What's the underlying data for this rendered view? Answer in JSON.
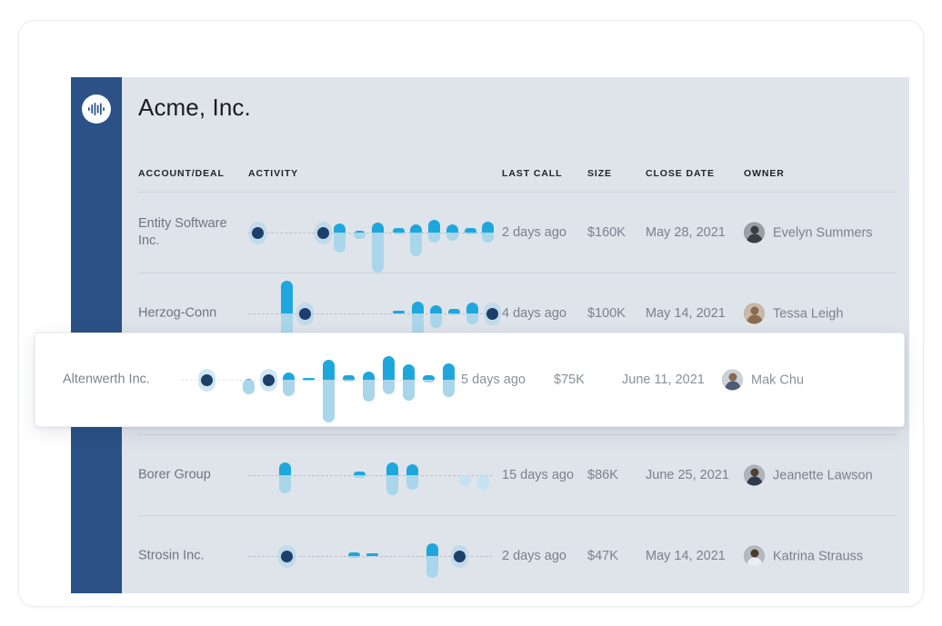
{
  "app": {
    "title": "Acme, Inc.",
    "logo_icon": "soundwave-icon",
    "sidebar_color": "#2b5186",
    "panel_color": "#dfe3ea"
  },
  "palette": {
    "dark_navy": "#1d3f6b",
    "accent_blue": "#1ea7dc",
    "light_blue": "#a9d6ea",
    "pale_blue": "#c6e2f1"
  },
  "table": {
    "columns": [
      {
        "key": "account",
        "label": "ACCOUNT/DEAL"
      },
      {
        "key": "activity",
        "label": "ACTIVITY"
      },
      {
        "key": "lastcall",
        "label": "LAST CALL"
      },
      {
        "key": "size",
        "label": "SIZE"
      },
      {
        "key": "closedate",
        "label": "CLOSE DATE"
      },
      {
        "key": "owner",
        "label": "OWNER"
      }
    ],
    "rows": [
      {
        "account": "Entity Software Inc.",
        "lastcall": "2 days ago",
        "size": "$160K",
        "closedate": "May 28, 2021",
        "owner": "Evelyn Summers",
        "avatar": "avatar-evelyn-summers"
      },
      {
        "account": "Herzog-Conn",
        "lastcall": "4 days ago",
        "size": "$100K",
        "closedate": "May 14, 2021",
        "owner": "Tessa Leigh",
        "avatar": "avatar-tessa-leigh"
      },
      {
        "account": "Borer Group",
        "lastcall": "15 days ago",
        "size": "$86K",
        "closedate": "June 25, 2021",
        "owner": "Jeanette Lawson",
        "avatar": "avatar-jeanette-lawson"
      },
      {
        "account": "Strosin Inc.",
        "lastcall": "2 days ago",
        "size": "$47K",
        "closedate": "May 14, 2021",
        "owner": "Katrina Strauss",
        "avatar": "avatar-katrina-strauss"
      }
    ],
    "highlighted_row": {
      "account": "Altenwerth Inc.",
      "lastcall": "5 days ago",
      "size": "$75K",
      "closedate": "June 11, 2021",
      "owner": "Mak Chu",
      "avatar": "avatar-mak-chu"
    }
  },
  "chart_data": {
    "type": "bar",
    "title": "Activity sparklines per account",
    "description": "Diverging capsule sparkline; positive (up) segment drawn in accent blue above a dashed zero baseline, negative (down) segment in light blue below. Dark navy circles mark zero/neutral activity markers.",
    "xlabel": "",
    "ylabel": "",
    "grid": false,
    "legend": "none",
    "baseline": 0,
    "series": [
      {
        "name": "Entity Software Inc.",
        "marks": [
          {
            "x": 4,
            "up": 0,
            "down": 0,
            "type": "dot"
          },
          {
            "x": 76,
            "up": 0,
            "down": 0,
            "type": "dot"
          },
          {
            "x": 94,
            "up": 10,
            "down": 22,
            "type": "pill"
          },
          {
            "x": 116,
            "up": 2,
            "down": 7,
            "type": "pill"
          },
          {
            "x": 136,
            "up": 11,
            "down": 44,
            "type": "pill"
          },
          {
            "x": 159,
            "up": 5,
            "down": 2,
            "type": "pill"
          },
          {
            "x": 178,
            "up": 9,
            "down": 26,
            "type": "pill"
          },
          {
            "x": 198,
            "up": 14,
            "down": 11,
            "type": "pill"
          },
          {
            "x": 218,
            "up": 9,
            "down": 9,
            "type": "pill"
          },
          {
            "x": 238,
            "up": 5,
            "down": 2,
            "type": "pill"
          },
          {
            "x": 257,
            "up": 12,
            "down": 11,
            "type": "pill"
          }
        ]
      },
      {
        "name": "Herzog-Conn",
        "marks": [
          {
            "x": 36,
            "up": 36,
            "down": 40,
            "type": "pill"
          },
          {
            "x": 56,
            "up": 0,
            "down": 0,
            "type": "dot"
          },
          {
            "x": 159,
            "up": 3,
            "down": 0,
            "type": "pill"
          },
          {
            "x": 180,
            "up": 13,
            "down": 25,
            "type": "pill"
          },
          {
            "x": 200,
            "up": 9,
            "down": 16,
            "type": "pill"
          },
          {
            "x": 220,
            "up": 5,
            "down": 2,
            "type": "pill"
          },
          {
            "x": 240,
            "up": 12,
            "down": 12,
            "type": "pill"
          },
          {
            "x": 262,
            "up": 0,
            "down": 0,
            "type": "dot"
          }
        ]
      },
      {
        "name": "Altenwerth Inc.",
        "marks": [
          {
            "x": 22,
            "up": 0,
            "down": 0,
            "type": "dot"
          },
          {
            "x": 68,
            "up": 1,
            "down": 16,
            "type": "pill"
          },
          {
            "x": 90,
            "up": 0,
            "down": 0,
            "type": "dot"
          },
          {
            "x": 112,
            "up": 8,
            "down": 18,
            "type": "pill"
          },
          {
            "x": 134,
            "up": 2,
            "down": 1,
            "type": "pill"
          },
          {
            "x": 156,
            "up": 22,
            "down": 47,
            "type": "pill"
          },
          {
            "x": 178,
            "up": 5,
            "down": 2,
            "type": "pill"
          },
          {
            "x": 200,
            "up": 9,
            "down": 24,
            "type": "pill"
          },
          {
            "x": 222,
            "up": 26,
            "down": 16,
            "type": "pill"
          },
          {
            "x": 244,
            "up": 17,
            "down": 23,
            "type": "pill"
          },
          {
            "x": 266,
            "up": 5,
            "down": 3,
            "type": "pill"
          },
          {
            "x": 288,
            "up": 18,
            "down": 19,
            "type": "pill"
          }
        ]
      },
      {
        "name": "Borer Group",
        "marks": [
          {
            "x": 34,
            "up": 14,
            "down": 20,
            "type": "pill"
          },
          {
            "x": 116,
            "up": 4,
            "down": 3,
            "type": "pill"
          },
          {
            "x": 152,
            "up": 14,
            "down": 22,
            "type": "pill"
          },
          {
            "x": 174,
            "up": 12,
            "down": 16,
            "type": "pill"
          },
          {
            "x": 232,
            "up": 0,
            "down": 12,
            "type": "pill"
          },
          {
            "x": 252,
            "up": 0,
            "down": 16,
            "type": "pill"
          }
        ]
      },
      {
        "name": "Strosin Inc.",
        "marks": [
          {
            "x": 36,
            "up": 0,
            "down": 0,
            "type": "dot"
          },
          {
            "x": 110,
            "up": 4,
            "down": 2,
            "type": "pill"
          },
          {
            "x": 130,
            "up": 3,
            "down": 0,
            "type": "pill"
          },
          {
            "x": 196,
            "up": 14,
            "down": 24,
            "type": "pill"
          },
          {
            "x": 226,
            "up": 0,
            "down": 0,
            "type": "dot"
          }
        ]
      }
    ]
  }
}
